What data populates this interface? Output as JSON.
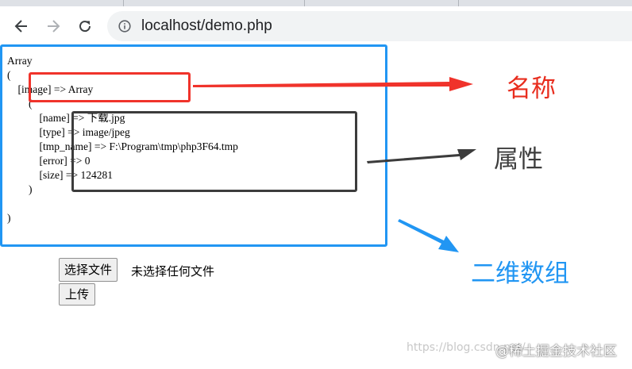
{
  "browser": {
    "url": "localhost/demo.php",
    "back_icon": "arrow-left",
    "forward_icon": "arrow-right",
    "reload_icon": "reload",
    "site_info_icon": "info-circle"
  },
  "dump_lines": [
    "Array",
    "(",
    "    [image] => Array",
    "        (",
    "            [name] => 下载.jpg",
    "            [type] => image/jpeg",
    "            [tmp_name] => F:\\Program\\tmp\\php3F64.tmp",
    "            [error] => 0",
    "            [size] => 124281",
    "        )",
    "",
    ")"
  ],
  "annotations": {
    "name_label": "名称",
    "attr_label": "属性",
    "two_dim_label": "二维数组"
  },
  "colors": {
    "red": "#f0332b",
    "dark": "#3c3c3c",
    "blue": "#2196f3"
  },
  "form": {
    "choose_file_label": "选择文件",
    "no_file_text": "未选择任何文件",
    "upload_label": "上传"
  },
  "watermark": {
    "csdn_text": "https://blog.csdn.net/",
    "brand_text": "@稀土掘金技术社区"
  }
}
